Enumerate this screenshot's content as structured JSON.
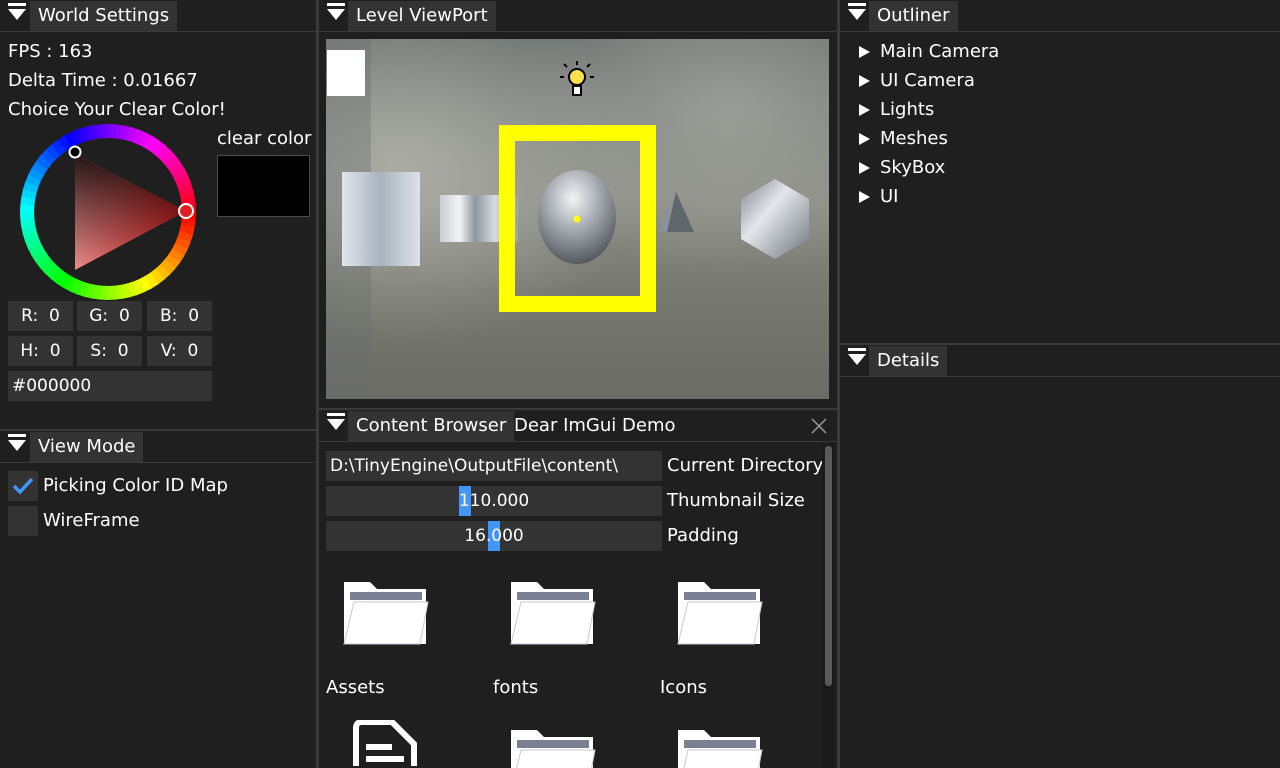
{
  "world_settings": {
    "title": "World Settings",
    "fps": "FPS : 163",
    "delta_time": "Delta Time : 0.01667",
    "prompt": "Choice Your Clear Color!",
    "clear_color_label": "clear color",
    "clear_color_value": "#000000",
    "rgb": [
      {
        "label": "R:",
        "value": "0"
      },
      {
        "label": "G:",
        "value": "0"
      },
      {
        "label": "B:",
        "value": "0"
      }
    ],
    "hsv": [
      {
        "label": "H:",
        "value": "0"
      },
      {
        "label": "S:",
        "value": "0"
      },
      {
        "label": "V:",
        "value": "0"
      }
    ],
    "hex": "#000000"
  },
  "view_mode": {
    "title": "View Mode",
    "options": [
      {
        "label": "Picking Color ID Map",
        "checked": true
      },
      {
        "label": "WireFrame",
        "checked": false
      }
    ]
  },
  "viewport": {
    "title": "Level ViewPort"
  },
  "content_browser": {
    "tabs": [
      "Content Browser",
      "Dear ImGui Demo"
    ],
    "directory_value": "D:\\TinyEngine\\OutputFile\\content\\",
    "directory_label": "Current Directory",
    "thumbnail_value": "110.000",
    "thumbnail_label": "Thumbnail Size",
    "thumbnail_fraction": 0.41,
    "padding_value": "16.000",
    "padding_label": "Padding",
    "padding_fraction": 0.5,
    "items": [
      {
        "name": "Assets",
        "icon": "folder-icon"
      },
      {
        "name": "fonts",
        "icon": "folder-icon"
      },
      {
        "name": "Icons",
        "icon": "folder-icon"
      }
    ]
  },
  "outliner": {
    "title": "Outliner",
    "items": [
      "Main Camera",
      "UI Camera",
      "Lights",
      "Meshes",
      "SkyBox",
      "UI"
    ]
  },
  "details": {
    "title": "Details"
  },
  "colors": {
    "accent": "#4296fa",
    "selection": "#ffff00",
    "panel_bg": "#1f1f1f",
    "field_bg": "#333333"
  }
}
